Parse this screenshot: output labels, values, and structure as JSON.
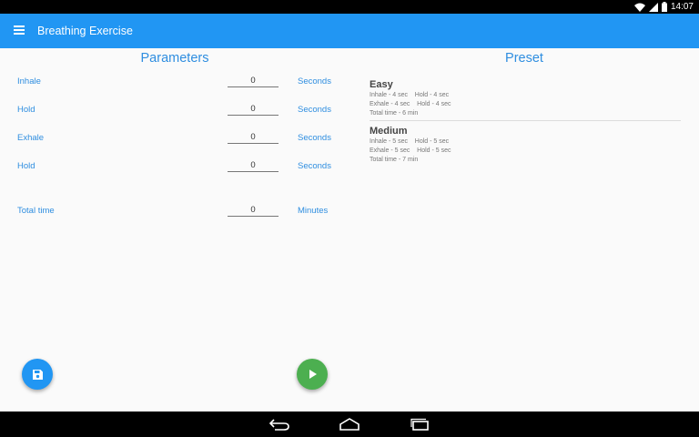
{
  "status_bar": {
    "time": "14:07"
  },
  "app_bar": {
    "title": "Breathing Exercise"
  },
  "parameters": {
    "title": "Parameters",
    "rows": [
      {
        "label": "Inhale",
        "value": "0",
        "unit": "Seconds"
      },
      {
        "label": "Hold",
        "value": "0",
        "unit": "Seconds"
      },
      {
        "label": "Exhale",
        "value": "0",
        "unit": "Seconds"
      },
      {
        "label": "Hold",
        "value": "0",
        "unit": "Seconds"
      },
      {
        "label": "Total time",
        "value": "0",
        "unit": "Minutes"
      }
    ]
  },
  "preset": {
    "title": "Preset",
    "items": [
      {
        "name": "Easy",
        "line1": "Inhale - 4 sec    Hold - 4 sec",
        "line2": "Exhale - 4 sec    Hold - 4 sec",
        "line3": "Total time - 6 min"
      },
      {
        "name": "Medium",
        "line1": "Inhale - 5 sec    Hold - 5 sec",
        "line2": "Exhale - 5 sec    Hold - 5 sec",
        "line3": "Total time - 7 min"
      }
    ]
  },
  "colors": {
    "primary": "#2196f3",
    "accent_text": "#2f8ee0",
    "play_button": "#4caf50"
  },
  "icons": {
    "menu": "menu-icon",
    "save": "save-icon",
    "play": "play-icon",
    "back": "back-icon",
    "home": "home-icon",
    "recent": "recent-apps-icon"
  }
}
